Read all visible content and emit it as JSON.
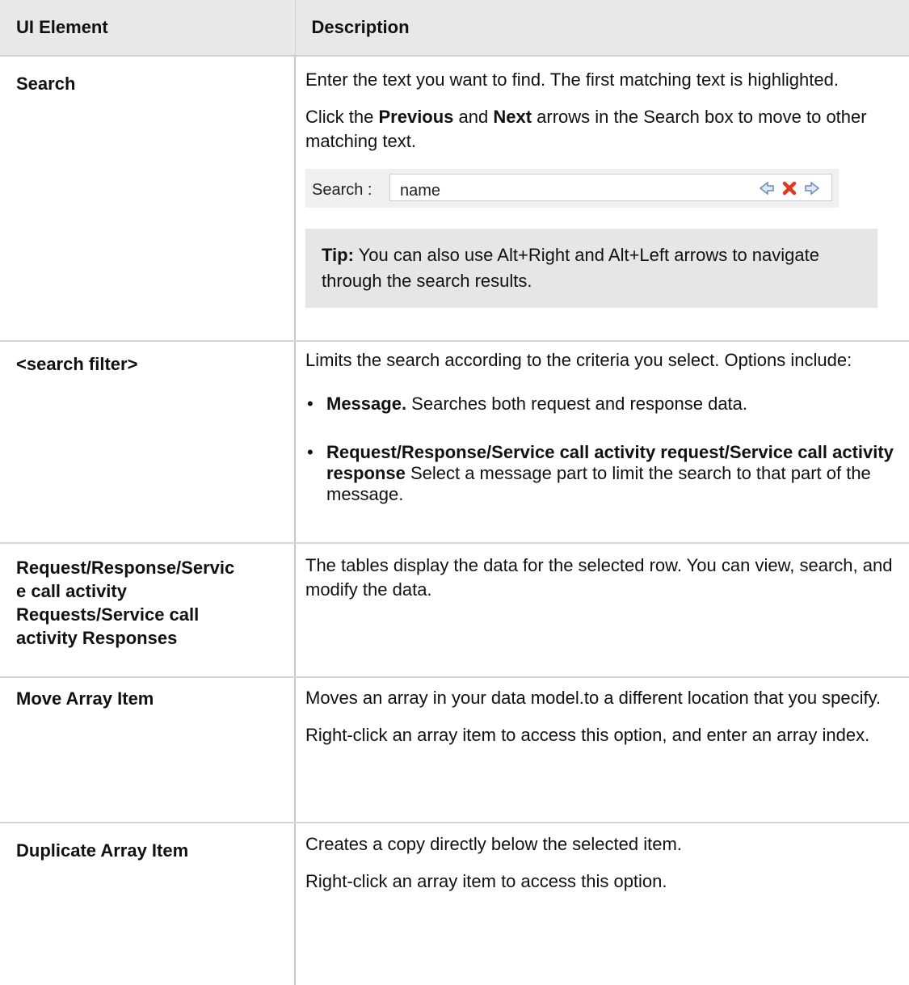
{
  "table": {
    "header": {
      "col1": "UI Element",
      "col2": "Description"
    },
    "search": {
      "name": "Search",
      "desc1": "Enter the text you want to find. The first matching text is highlighted.",
      "desc2_pre": "Click the ",
      "desc2_b1": "Previous",
      "desc2_mid": " and ",
      "desc2_b2": "Next",
      "desc2_post": " arrows in the Search box to move to other matching text.",
      "box_label": "Search :",
      "box_value": "name",
      "tip_label": "Tip:",
      "tip_text": " You can also use Alt+Right and Alt+Left arrows to navigate through the search results."
    },
    "filter": {
      "name": "<search filter>",
      "desc": "Limits the search according to the criteria you select. Options include:",
      "opt1_b": "Message.",
      "opt1_t": " Searches both request and response data.",
      "opt2_b": "Request/Response/Service call activity request/Service call activity response",
      "opt2_t": " Select a message part to limit the search to that part of the message."
    },
    "tables": {
      "name_l1": "Request/Response/Servic",
      "name_l2": "e call activity",
      "name_l3": "Requests/Service call",
      "name_l4": "activity Responses",
      "desc": "The tables display the data for the selected row. You can view, search, and modify the data."
    },
    "move": {
      "name": "Move Array Item",
      "desc1": "Moves an array in your data model.to a different location that you specify.",
      "desc2": "Right-click an array item to access this option, and enter an array index."
    },
    "duplicate": {
      "name": "Duplicate Array Item",
      "desc1": "Creates a copy directly below the selected item.",
      "desc2": "Right-click an array item to access this option."
    }
  },
  "icons": {
    "prev": "left-arrow-icon",
    "clear": "red-x-icon",
    "next": "right-arrow-icon"
  },
  "colors": {
    "header_bg": "#e8e8e8",
    "tip_bg": "#e6e6e6",
    "clear_icon": "#e03a1e",
    "arrow_icon": "#6b8bb8"
  }
}
